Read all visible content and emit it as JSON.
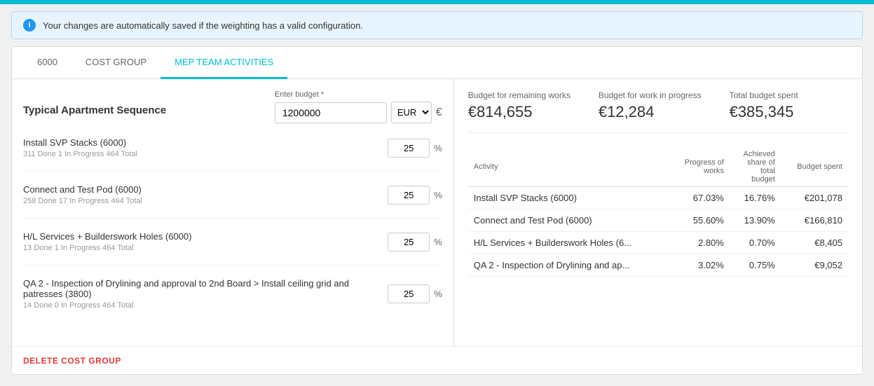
{
  "topbar": {},
  "banner": {
    "text": "Your changes are automatically saved if the weighting has a valid configuration."
  },
  "tabs": [
    {
      "id": "6000",
      "label": "6000",
      "active": false
    },
    {
      "id": "cost-group",
      "label": "COST GROUP",
      "active": false
    },
    {
      "id": "mep-team",
      "label": "MEP TEAM ACTIVITIES",
      "active": true
    }
  ],
  "left": {
    "sequence_label": "Typical Apartment Sequence",
    "budget_input_label": "Enter budget *",
    "budget_value": "1200000",
    "currency": "EUR",
    "currency_symbol": "€",
    "activities": [
      {
        "name": "Install SVP Stacks (6000)",
        "sub": "311 Done 1 In Progress 464 Total",
        "weight": "25"
      },
      {
        "name": "Connect and Test Pod (6000)",
        "sub": "258 Done 17 In Progress 464 Total",
        "weight": "25"
      },
      {
        "name": "H/L Services + Builderswork Holes (6000)",
        "sub": "13 Done 1 In Progress 464 Total",
        "weight": "25"
      },
      {
        "name": "QA 2 - Inspection of Drylining and approval to 2nd Board > Install ceiling grid and patresses (3800)",
        "sub": "14 Done 0 In Progress 464 Total",
        "weight": "25"
      }
    ]
  },
  "right": {
    "summary": [
      {
        "label": "Budget for remaining works",
        "value": "€814,655"
      },
      {
        "label": "Budget for work in progress",
        "value": "€12,284"
      },
      {
        "label": "Total budget spent",
        "value": "€385,345"
      }
    ],
    "table": {
      "headers": [
        "Activity",
        "Progress of works",
        "Achieved share of total budget",
        "Budget spent"
      ],
      "rows": [
        {
          "activity": "Install SVP Stacks (6000)",
          "progress": "67.03%",
          "achieved": "16.76%",
          "budget": "€201,078"
        },
        {
          "activity": "Connect and Test Pod (6000)",
          "progress": "55.60%",
          "achieved": "13.90%",
          "budget": "€166,810"
        },
        {
          "activity": "H/L Services + Builderswork Holes (6...",
          "progress": "2.80%",
          "achieved": "0.70%",
          "budget": "€8,405"
        },
        {
          "activity": "QA 2 - Inspection of Drylining and ap...",
          "progress": "3.02%",
          "achieved": "0.75%",
          "budget": "€9,052"
        }
      ]
    }
  },
  "footer": {
    "delete_label": "DELETE COST GROUP"
  }
}
